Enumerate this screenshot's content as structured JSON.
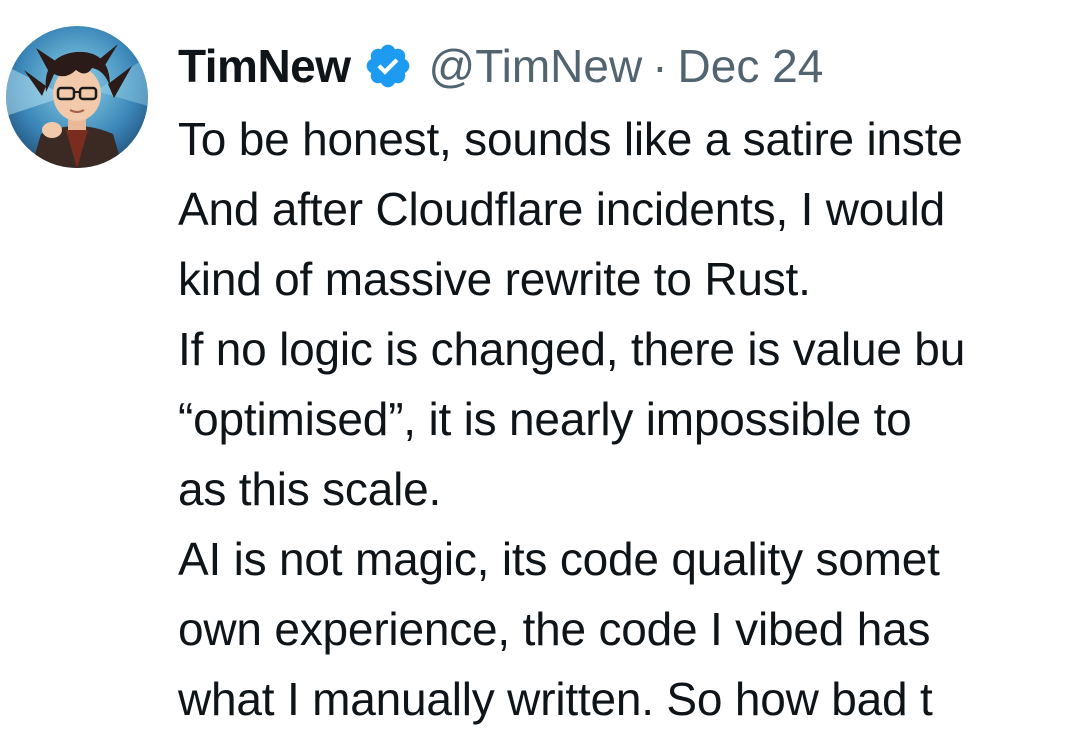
{
  "tweet": {
    "author": {
      "display_name": "TimNew",
      "handle": "@TimNew",
      "verified": true,
      "avatar_icon": "anime-character-avatar"
    },
    "separator": "·",
    "date": "Dec 24",
    "lines": [
      "To be honest, sounds like a satire inste",
      "And after Cloudflare incidents, I would",
      "kind of massive rewrite to Rust.",
      "If no logic is changed, there is value bu",
      "“optimised”, it is nearly impossible to",
      "as this scale.",
      "AI is not magic, its code quality somet",
      "own experience, the code I vibed has",
      "what I manually written. So how bad t"
    ]
  },
  "colors": {
    "text": "#0f1419",
    "secondary": "#536471",
    "verified_badge": "#1d9bf0"
  }
}
